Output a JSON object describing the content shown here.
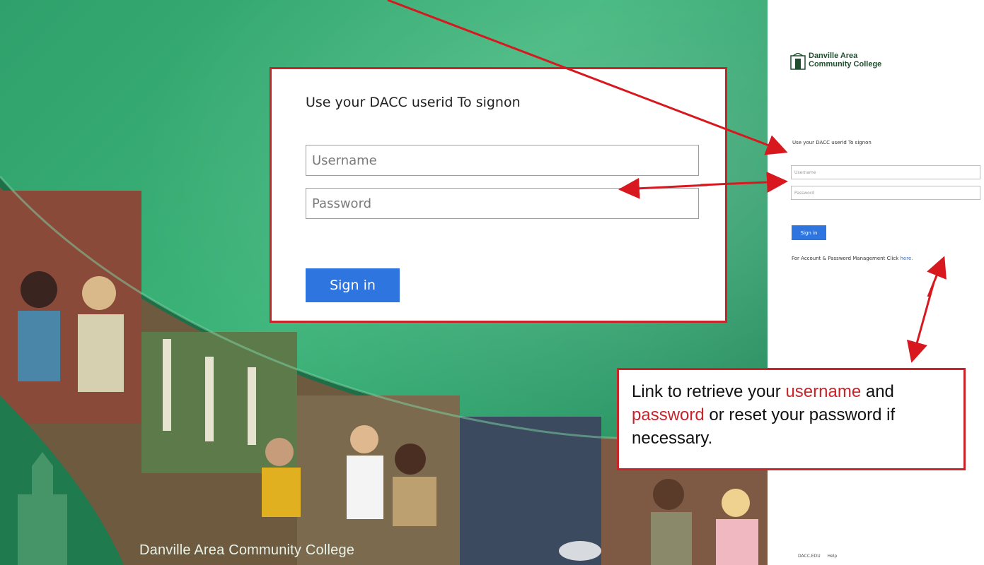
{
  "zoomed_form": {
    "title": "Use your DACC userid To signon",
    "username_placeholder": "Username",
    "password_placeholder": "Password",
    "signin_label": "Sign in"
  },
  "login_page": {
    "logo_line1": "Danville Area",
    "logo_line2": "Community College",
    "title": "Use your DACC userid To signon",
    "username_placeholder": "Username",
    "password_placeholder": "Password",
    "signin_label": "Sign in",
    "manage_text": "For Account & Password Management Click ",
    "manage_link": "here.",
    "footer_links": [
      "DACC.EDU",
      "Help"
    ]
  },
  "background": {
    "college_name": "Danville Area Community College"
  },
  "annotation": {
    "text_1": "Link to retrieve your ",
    "word_username": "username",
    "text_2": " and ",
    "word_password": "password",
    "text_3": " or reset your password if necessary."
  },
  "colors": {
    "primary_button": "#2f75e0",
    "callout_border": "#c8242a",
    "brand_green": "#3db57a"
  }
}
